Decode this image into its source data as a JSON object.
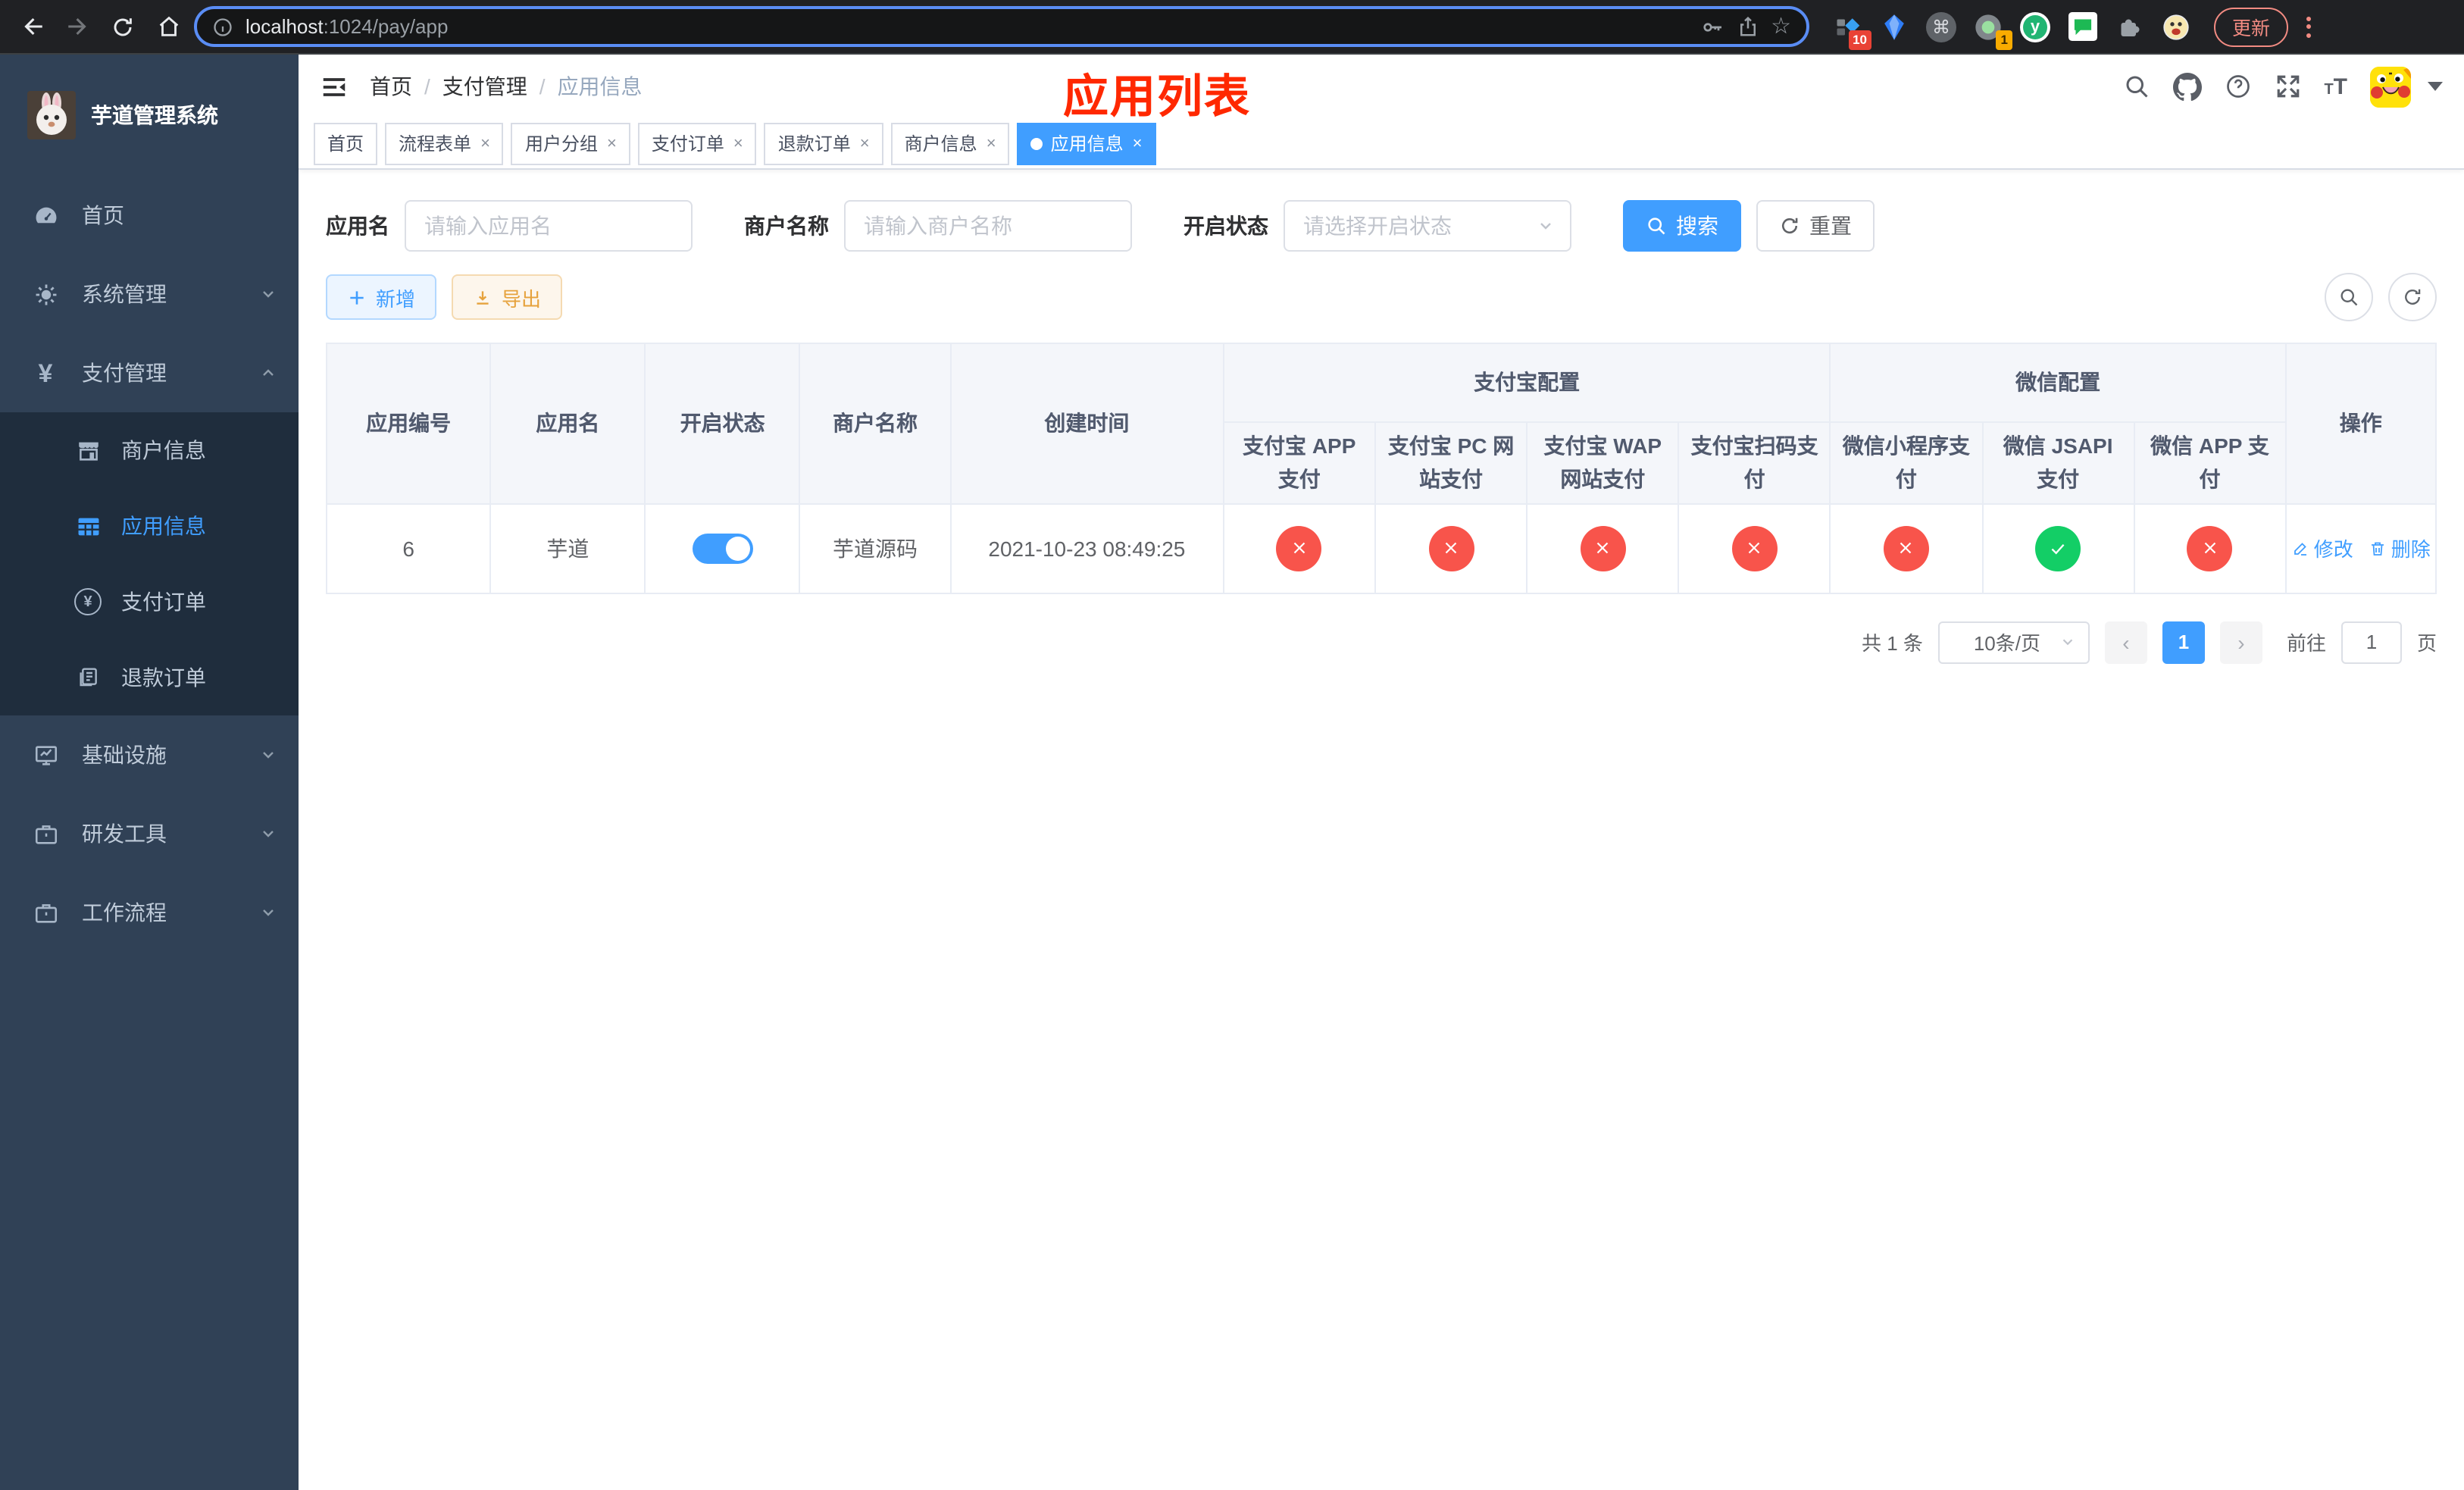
{
  "browser": {
    "url_host": "localhost",
    "url_path": ":1024/pay/app",
    "update_label": "更新",
    "ext_badge_pinned": "10",
    "ext_badge_recorder": "1",
    "ext_letter": "y"
  },
  "glyphs": {
    "breadcrumb_sep": "/",
    "tab_close": "×",
    "star": "☆",
    "command": "⌘",
    "prev_arrow": "‹",
    "next_arrow": "›"
  },
  "sidebar": {
    "app_title": "芋道管理系统",
    "home": "首页",
    "system": "系统管理",
    "pay": "支付管理",
    "pay_children": {
      "merchant": "商户信息",
      "app": "应用信息",
      "order": "支付订单",
      "refund": "退款订单"
    },
    "infra": "基础设施",
    "devtool": "研发工具",
    "workflow": "工作流程"
  },
  "header": {
    "breadcrumb": [
      "首页",
      "支付管理",
      "应用信息"
    ],
    "annotation": "应用列表"
  },
  "tabs": [
    "首页",
    "流程表单",
    "用户分组",
    "支付订单",
    "退款订单",
    "商户信息",
    "应用信息"
  ],
  "filters": {
    "app_name_label": "应用名",
    "app_name_placeholder": "请输入应用名",
    "merchant_label": "商户名称",
    "merchant_placeholder": "请输入商户名称",
    "status_label": "开启状态",
    "status_placeholder": "请选择开启状态",
    "search_label": "搜索",
    "reset_label": "重置"
  },
  "toolbar": {
    "add_label": "新增",
    "export_label": "导出"
  },
  "table": {
    "headers": {
      "app_id": "应用编号",
      "app_name": "应用名",
      "status": "开启状态",
      "merchant": "商户名称",
      "created": "创建时间",
      "alipay_group": "支付宝配置",
      "wechat_group": "微信配置",
      "alipay_app": "支付宝 APP 支付",
      "alipay_pc": "支付宝 PC 网站支付",
      "alipay_wap": "支付宝 WAP 网站支付",
      "alipay_qr": "支付宝扫码支付",
      "wx_mini": "微信小程序支付",
      "wx_jsapi": "微信 JSAPI 支付",
      "wx_app": "微信 APP 支付",
      "ops": "操作"
    },
    "row": {
      "id": "6",
      "name": "芋道",
      "enabled": true,
      "merchant": "芋道源码",
      "created": "2021-10-23 08:49:25",
      "channels": {
        "alipay_app": false,
        "alipay_pc": false,
        "alipay_wap": false,
        "alipay_qr": false,
        "wx_mini": false,
        "wx_jsapi": true,
        "wx_app": false
      }
    },
    "ops": {
      "edit": "修改",
      "delete": "删除"
    }
  },
  "pagination": {
    "total": "共 1 条",
    "per_page": "10条/页",
    "page": "1",
    "goto_label": "前往",
    "goto_value": "1",
    "page_unit": "页"
  }
}
